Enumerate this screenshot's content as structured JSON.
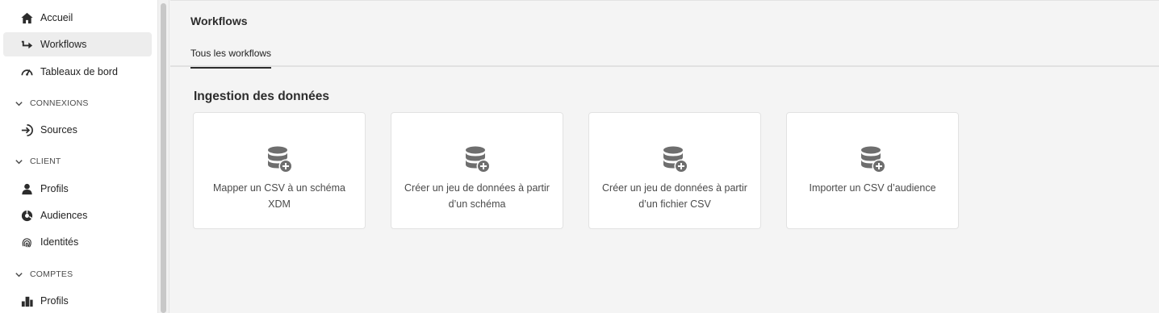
{
  "sidebar": {
    "items": [
      {
        "label": "Accueil",
        "icon": "home-icon",
        "active": false
      },
      {
        "label": "Workflows",
        "icon": "workflow-icon",
        "active": true
      },
      {
        "label": "Tableaux de bord",
        "icon": "gauge-icon",
        "active": false
      }
    ],
    "sections": [
      {
        "title": "CONNEXIONS",
        "items": [
          {
            "label": "Sources",
            "icon": "sources-icon"
          }
        ]
      },
      {
        "title": "CLIENT",
        "items": [
          {
            "label": "Profils",
            "icon": "user-icon"
          },
          {
            "label": "Audiences",
            "icon": "audiences-icon"
          },
          {
            "label": "Identités",
            "icon": "fingerprint-icon"
          }
        ]
      },
      {
        "title": "COMPTES",
        "items": [
          {
            "label": "Profils",
            "icon": "buildings-icon"
          }
        ]
      }
    ]
  },
  "header": {
    "title": "Workflows",
    "tabs": [
      {
        "label": "Tous les workflows",
        "active": true
      }
    ]
  },
  "main": {
    "section_title": "Ingestion des données",
    "cards": [
      {
        "label": "Mapper un CSV à un schéma XDM",
        "icon": "database-add-icon"
      },
      {
        "label": "Créer un jeu de données à partir d’un schéma",
        "icon": "database-add-icon"
      },
      {
        "label": "Créer un jeu de données à partir d’un fichier CSV",
        "icon": "database-add-icon"
      },
      {
        "label": "Importer un CSV d’audience",
        "icon": "database-add-icon"
      }
    ]
  },
  "colors": {
    "background": "#f4f4f4",
    "sidebar_bg": "#ffffff",
    "active_item_bg": "#ededed",
    "icon_gray": "#6e6e6e",
    "text": "#2c2c2c"
  }
}
